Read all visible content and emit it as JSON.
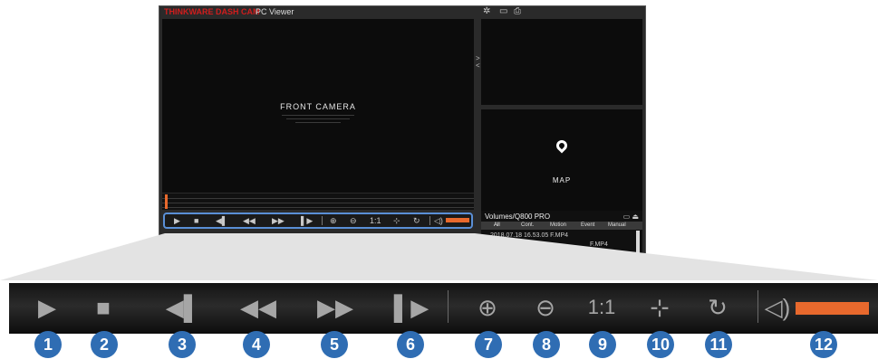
{
  "app": {
    "brand": "THINKWARE DASH CAM",
    "name": "PC Viewer"
  },
  "title_icons": [
    "gear-icon",
    "folder-icon",
    "printer-icon"
  ],
  "video": {
    "label": "FRONT CAMERA"
  },
  "map": {
    "label": "MAP"
  },
  "file_panel": {
    "volume": "Volumes/Q800 PRO",
    "tabs": [
      "All",
      "Cont.",
      "Motion",
      "Event",
      "Manual"
    ],
    "files": [
      "2018.07.18 16.53.05 F.MP4",
      "F.MP4"
    ]
  },
  "controls": {
    "buttons": [
      {
        "name": "play-icon",
        "glyph": "▶"
      },
      {
        "name": "stop-icon",
        "glyph": "■"
      },
      {
        "name": "previous-frame-icon",
        "glyph": "◀▌"
      },
      {
        "name": "rewind-icon",
        "glyph": "◀◀"
      },
      {
        "name": "fast-forward-icon",
        "glyph": "▶▶"
      },
      {
        "name": "next-frame-icon",
        "glyph": "▌▶"
      },
      {
        "name": "zoom-in-icon",
        "glyph": "⊕"
      },
      {
        "name": "zoom-out-icon",
        "glyph": "⊖"
      },
      {
        "name": "actual-size-label",
        "glyph": "1:1"
      },
      {
        "name": "fullscreen-icon",
        "glyph": "⊹"
      },
      {
        "name": "rotate-icon",
        "glyph": "↻"
      },
      {
        "name": "volume-icon",
        "glyph": "🔉"
      }
    ],
    "volume_level": 1.0,
    "accent_color": "#e8692d"
  },
  "callouts": [
    "1",
    "2",
    "3",
    "4",
    "5",
    "6",
    "7",
    "8",
    "9",
    "10",
    "11",
    "12"
  ],
  "colors": {
    "brand": "#d01d1d",
    "callout": "#2f6db3",
    "highlight": "#5a8fd6"
  }
}
